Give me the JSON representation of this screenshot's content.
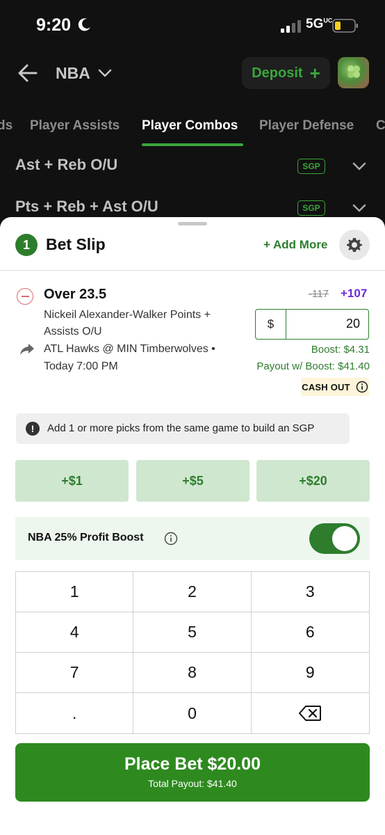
{
  "status_bar": {
    "time": "9:20",
    "network": "5G",
    "network_suffix": "UC"
  },
  "header": {
    "league": "NBA",
    "deposit_label": "Deposit",
    "deposit_plus": "+"
  },
  "tabs": [
    {
      "label": "ds",
      "active": false
    },
    {
      "label": "Player Assists",
      "active": false
    },
    {
      "label": "Player Combos",
      "active": true
    },
    {
      "label": "Player Defense",
      "active": false
    },
    {
      "label": "C",
      "active": false
    }
  ],
  "markets": [
    {
      "name": "Ast + Reb O/U",
      "badge": "SGP"
    },
    {
      "name": "Pts + Reb + Ast O/U",
      "badge": "SGP"
    }
  ],
  "bet_slip": {
    "count": "1",
    "title": "Bet Slip",
    "add_more": "+ Add More",
    "bet": {
      "selection": "Over 23.5",
      "market": "Nickeil Alexander-Walker Points + Assists O/U",
      "game": "ATL Hawks @ MIN Timberwolves • Today 7:00 PM",
      "old_odds": "-117",
      "odds": "+107",
      "currency": "$",
      "stake": "20",
      "boost": "Boost: $4.31",
      "payout_with_boost": "Payout w/ Boost: $41.40",
      "cash_out": "CASH OUT"
    },
    "sgp_notice": "Add 1 or more picks from the same game to build an SGP",
    "quick_amounts": [
      "+$1",
      "+$5",
      "+$20"
    ],
    "profit_boost": {
      "label": "NBA 25% Profit Boost",
      "enabled": true
    },
    "keypad": [
      "1",
      "2",
      "3",
      "4",
      "5",
      "6",
      "7",
      "8",
      "9",
      ".",
      "0",
      "backspace"
    ],
    "place_bet": {
      "label": "Place Bet $20.00",
      "total_payout": "Total Payout: $41.40"
    }
  },
  "colors": {
    "brand_green": "#2d7d2d",
    "button_green": "#2e8a1f",
    "odds_purple": "#6b2bd9",
    "remove_red": "#d86a6a"
  }
}
